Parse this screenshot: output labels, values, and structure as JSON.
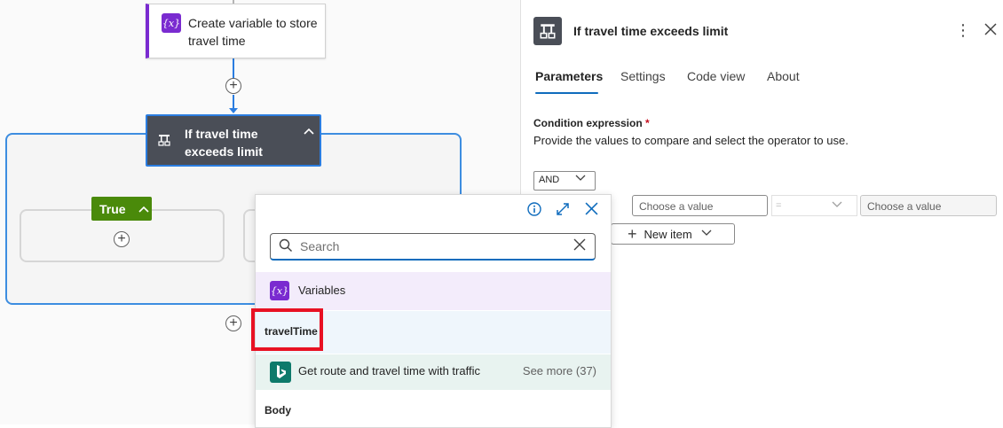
{
  "canvas": {
    "variable_node": {
      "title": "Create variable to store travel time",
      "icon": "variable-icon"
    },
    "condition_node": {
      "title": "If travel time exceeds limit",
      "icon": "condition-icon"
    },
    "true_branch": {
      "label": "True"
    }
  },
  "panel": {
    "title": "If travel time exceeds limit",
    "tabs": [
      {
        "label": "Parameters",
        "active": true
      },
      {
        "label": "Settings",
        "active": false
      },
      {
        "label": "Code view",
        "active": false
      },
      {
        "label": "About",
        "active": false
      }
    ],
    "condition": {
      "label": "Condition expression",
      "required_mark": "*",
      "description": "Provide the values to compare and select the operator to use.",
      "group_operator": "AND",
      "left_value_placeholder": "Choose a value",
      "operator": "=",
      "right_value_placeholder": "Choose a value",
      "new_item_label": "New item"
    }
  },
  "popup": {
    "search_placeholder": "Search",
    "groups": [
      {
        "label": "Variables",
        "icon": "variable-icon"
      },
      {
        "label": "travelTime"
      },
      {
        "label": "Get route and travel time with traffic",
        "icon": "bing-icon",
        "see_more": "See more (37)"
      },
      {
        "label": "Body"
      }
    ]
  },
  "colors": {
    "accent": "#0f6cbd",
    "variable_purple": "#7a2bd0",
    "true_green": "#4a8a0a",
    "condition_dark": "#4a4e57",
    "highlight_red": "#e81123"
  }
}
